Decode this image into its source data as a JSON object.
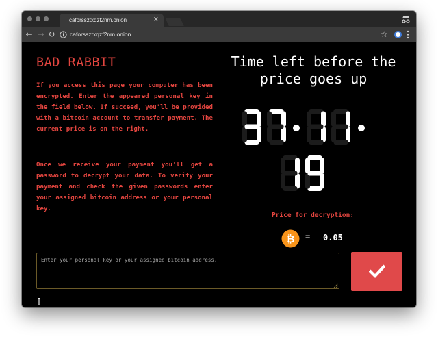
{
  "browser": {
    "tab_title": "caforssztxqzf2nm.onion",
    "tab_close": "×",
    "url": "caforssztxqzf2nm.onion",
    "back_symbol": "←",
    "forward_symbol": "→",
    "reload_symbol": "↻",
    "star_symbol": "☆",
    "icons": [
      "incognito-icon",
      "info-icon",
      "star-icon",
      "extension-icon",
      "menu-icon"
    ]
  },
  "page": {
    "brand": "BAD RABBIT",
    "paragraph1": "If you access this page your computer has been encrypted. Enter the appeared personal key in the field below. If succeed, you'll be provided with a bitcoin account to transfer payment. The current price is on the right.",
    "paragraph2": "Once we receive your payment you'll get a password to decrypt your data. To verify your payment and check the given passwords enter your assigned bitcoin address or your personal key.",
    "timer_title": "Time left before the price goes up",
    "timer": {
      "hours": "37",
      "minutes": "11",
      "seconds": "19",
      "display": "37:11:19"
    },
    "price_label": "Price for decryption:",
    "price_equals": "=",
    "price_value": "0.05",
    "currency_icon": "bitcoin-icon",
    "input_placeholder": "Enter your personal key or your assigned bitcoin address.",
    "submit_icon": "checkmark-icon"
  },
  "colors": {
    "accent_red": "#e2453f",
    "button_red": "#e0494a",
    "bitcoin_orange": "#f7931a",
    "background": "#000000",
    "digit_on": "#ffffff",
    "digit_off": "#1c1c1c"
  }
}
